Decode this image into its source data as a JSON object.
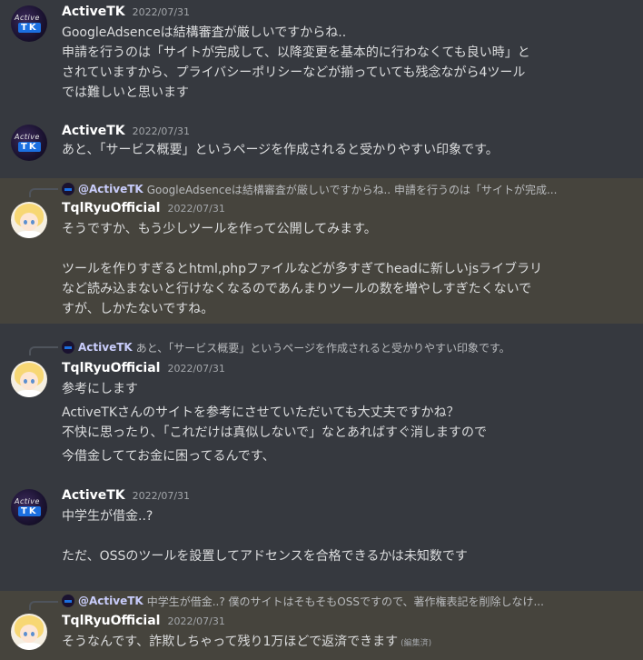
{
  "colors": {
    "background": "#36393f",
    "highlight": "#46443d",
    "username": "#ffffff",
    "timestamp": "#a3a6aa",
    "mention": "#c9cdfb"
  },
  "messages": [
    {
      "author": "ActiveTK",
      "timestamp": "2022/07/31",
      "avatar_text": [
        "Active",
        "TK"
      ],
      "lines": [
        "GoogleAdsenceは結構審査が厳しいですからね..",
        "申請を行うのは「サイトが完成して、以降変更を基本的に行わなくても良い時」と",
        "されていますから、プライバシーポリシーなどが揃っていても残念ながら4ツール",
        "では難しいと思います"
      ]
    },
    {
      "author": "ActiveTK",
      "timestamp": "2022/07/31",
      "avatar_text": [
        "Active",
        "TK"
      ],
      "lines": [
        "あと、「サービス概要」というページを作成されると受かりやすい印象です。"
      ]
    },
    {
      "reply_to": {
        "name": "@ActiveTK",
        "text": "GoogleAdsenceは結構審査が厳しいですからね.. 申請を行うのは「サイトが完成..."
      },
      "author": "TqlRyuOfficial",
      "timestamp": "2022/07/31",
      "lines": [
        "そうですか、もう少しツールを作って公開してみます。",
        "",
        "ツールを作りすぎるとhtml,phpファイルなどが多すぎてheadに新しいjsライブラリ",
        "など読み込まないと行けなくなるのであんまりツールの数を増やしすぎたくないで",
        "すが、しかたないですね。"
      ]
    },
    {
      "reply_to": {
        "name": "ActiveTK",
        "text": "あと、「サービス概要」というページを作成されると受かりやすい印象です。"
      },
      "author": "TqlRyuOfficial",
      "timestamp": "2022/07/31",
      "lines": [
        "参考にします",
        "ActiveTKさんのサイトを参考にさせていただいても大丈夫ですかね？",
        "不快に思ったり、「これだけは真似しないで」なとあればすぐ消しますので",
        "今借金しててお金に困ってるんです、"
      ]
    },
    {
      "author": "ActiveTK",
      "timestamp": "2022/07/31",
      "avatar_text": [
        "Active",
        "TK"
      ],
      "lines": [
        "中学生が借金..?",
        "",
        "ただ、OSSのツールを設置してアドセンスを合格できるかは未知数です"
      ]
    },
    {
      "reply_to": {
        "name": "@ActiveTK",
        "text": "中学生が借金..? 僕のサイトはそもそもOSSですので、著作権表記を削除しなけ..."
      },
      "author": "TqlRyuOfficial",
      "timestamp": "2022/07/31",
      "lines": [
        "そうなんです、詐欺しちゃって残り1万ほどで返済できます"
      ],
      "edited_label": "(編集済)"
    }
  ]
}
